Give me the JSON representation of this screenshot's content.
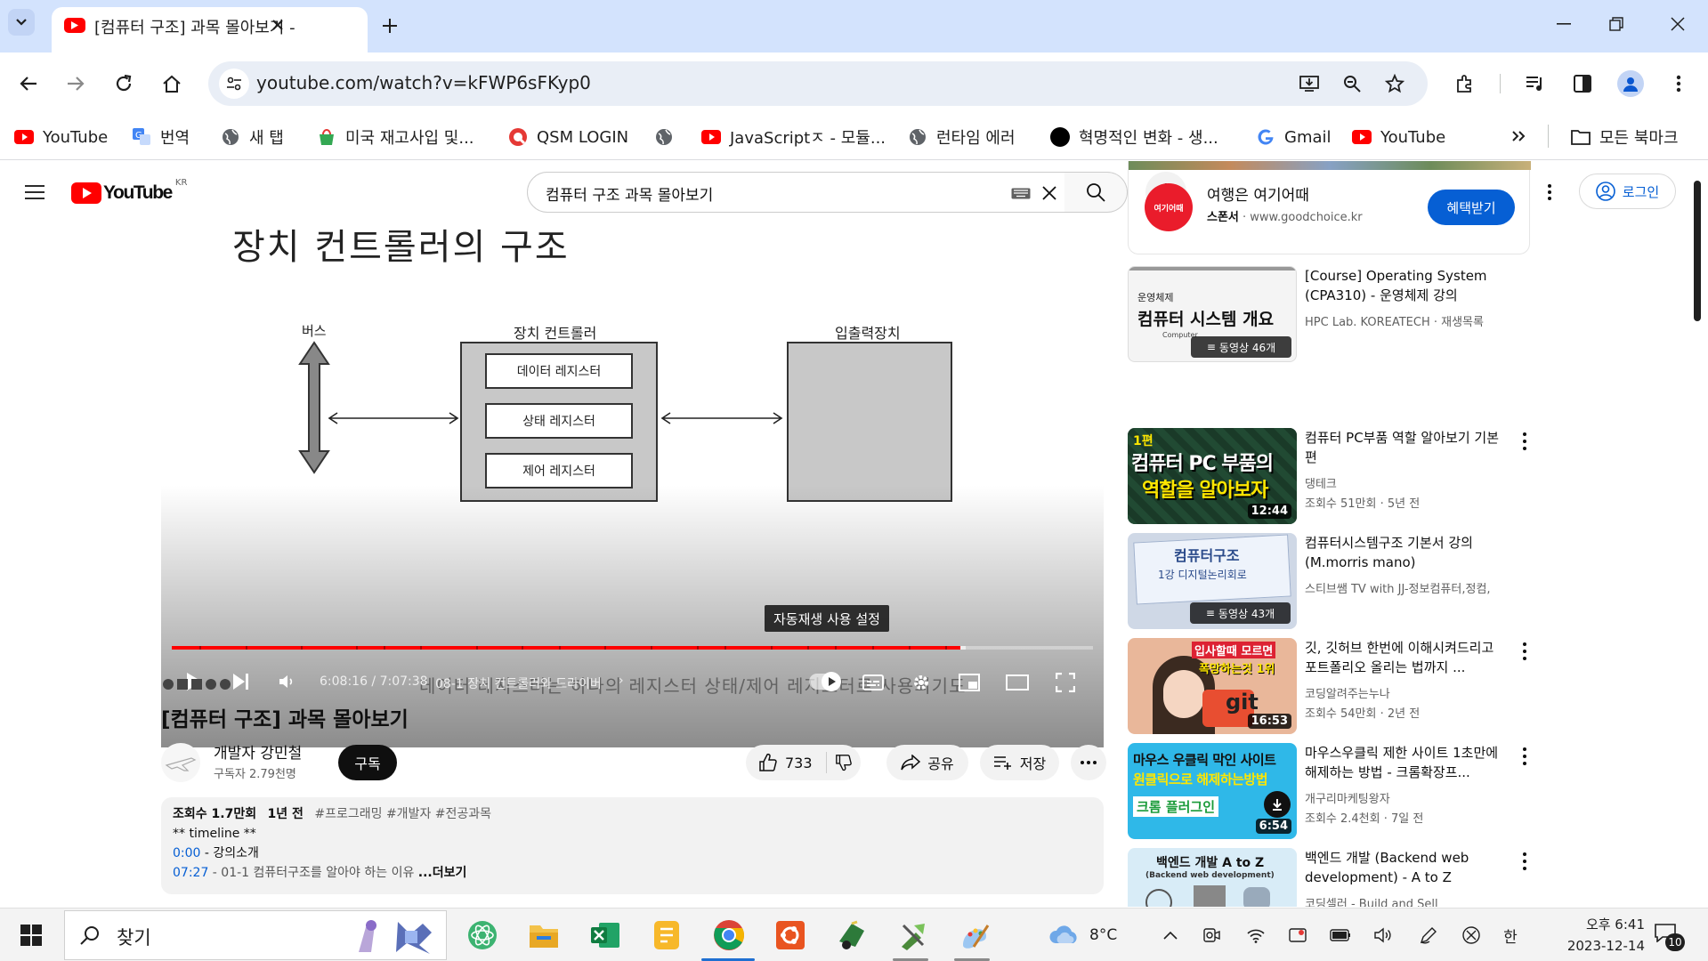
{
  "browser": {
    "tab_title": "[컴퓨터 구조] 과목 몰아보기 -",
    "url": "youtube.com/watch?v=kFWP6sFKyp0",
    "bookmarks": [
      {
        "label": "YouTube",
        "icon": "youtube-icon"
      },
      {
        "label": "번역",
        "icon": "translate-icon"
      },
      {
        "label": "새 탭",
        "icon": "globe-icon"
      },
      {
        "label": "미국 재고사입 및...",
        "icon": "shop-icon"
      },
      {
        "label": "QSM LOGIN",
        "icon": "qsm-icon"
      },
      {
        "label": "",
        "icon": "globe-icon"
      },
      {
        "label": "JavaScriptㅈ - 모듈...",
        "icon": "youtube-icon"
      },
      {
        "label": "런타임 에러",
        "icon": "globe-icon"
      },
      {
        "label": "혁명적인 변화 - 생...",
        "icon": "black-circle-icon"
      },
      {
        "label": "Gmail",
        "icon": "google-icon"
      },
      {
        "label": "YouTube",
        "icon": "youtube-icon"
      }
    ],
    "all_bookmarks": "모든 북마크"
  },
  "youtube": {
    "logo_region": "KR",
    "logo_text": "YouTube",
    "search_query": "컴퓨터 구조 과목 몰아보기",
    "login_label": "로그인",
    "video": {
      "slide_title": "장치 컨트롤러의 구조",
      "diagram": {
        "bus_label": "버스",
        "controller_label": "장치 컨트롤러",
        "io_label": "입출력장치",
        "registers": [
          "데이터 레지스터",
          "상태 레지스터",
          "제어 레지스터"
        ]
      },
      "caption": "데이터 레지스터는 하나의 레지스터 상태/제어 레지스터로 사용되기도",
      "autoplay_tooltip": "자동재생 사용 설정",
      "time": "6:08:16 / 7:07:38",
      "chapter": "08-1 장치 컨트롤러와 드라이버",
      "progress": 0.856,
      "buffered": 0.862
    },
    "title": "[컴퓨터 구조] 과목 몰아보기",
    "channel": {
      "name": "개발자 강민철",
      "subscribers": "구독자 2.79천명"
    },
    "subscribe_label": "구독",
    "like_count": "733",
    "share_label": "공유",
    "save_label": "저장",
    "description": {
      "views": "조회수 1.7만회",
      "age": "1년 전",
      "tags": "#프로그래밍 #개발자 #전공과목",
      "line1": "** timeline **",
      "t1": "0:00",
      "l1": " - 강의소개",
      "t2": "07:27",
      "l2": " - 01-1 컴퓨터구조를 알아야 하는 이유",
      "more": "...더보기"
    },
    "ad": {
      "logo": "여기어때",
      "title": "여행은 여기어때",
      "sponsor": "스폰서",
      "url": "www.goodchoice.kr",
      "button": "혜택받기"
    },
    "recommendations": [
      {
        "title": "[Course] Operating System (CPA310) - 운영체제 강의",
        "channel": "HPC Lab. KOREATECH · 재생목록",
        "meta": "",
        "thumb_caption": "운영체제",
        "thumb_main": "컴퓨터 시스템 개요",
        "thumb_sub": "Computer",
        "badge": "동영상 46개",
        "thumb_bg": "#f4f4f4"
      },
      {
        "title": "컴퓨터 PC부품 역할 알아보기 기본편",
        "channel": "댕테크",
        "meta": "조회수 51만회 · 5년 전",
        "thumb_caption": "1편",
        "thumb_main": "컴퓨터 PC 부품의",
        "thumb_sub": "역할을 알아보자",
        "badge": "12:44",
        "thumb_bg": "#1b3a2a"
      },
      {
        "title": "컴퓨터시스템구조 기본서 강의 (M.morris mano)",
        "channel": "스티브쌤 TV with JJ-정보컴퓨터,정컴,",
        "meta": "",
        "thumb_caption": "",
        "thumb_main": "컴퓨터구조",
        "thumb_sub": "1강 디지털논리회로",
        "badge": "동영상 43개",
        "thumb_bg": "#cfd8e6"
      },
      {
        "title": "깃, 깃허브 한번에 이해시켜드리고 포트폴리오 올리는 법까지 ...",
        "channel": "코딩알려주는누나",
        "meta": "조회수 54만회 · 2년 전",
        "thumb_caption": "입사할때 모르면",
        "thumb_main": "폭망하는것 1위",
        "thumb_sub": "git",
        "badge": "16:53",
        "thumb_bg": "#e9b79a"
      },
      {
        "title": "마우스우클릭 제한 사이트 1초만에 해제하는 방법 - 크롬확장프...",
        "channel": "개구리마케팅왕자",
        "meta": "조회수 2.4천회 · 7일 전",
        "thumb_caption": "마우스 우클릭 막인 사이트",
        "thumb_main": "원클릭으로 해제하는방법",
        "thumb_sub": "크롬 플러그인",
        "badge": "6:54",
        "thumb_bg": "#2fb8e8"
      },
      {
        "title": "백엔드 개발 (Backend web development) - A to Z",
        "channel": "코딩셀러 - Build and Sell",
        "meta": "",
        "thumb_caption": "백엔드 개발 A to Z",
        "thumb_main": "(Backend web development)",
        "thumb_sub": "",
        "badge": "",
        "thumb_bg": "#d8ecf7"
      }
    ]
  },
  "taskbar": {
    "search_placeholder": "찾기",
    "weather": "8°C",
    "ime": "한",
    "time": "오후 6:41",
    "date": "2023-12-14",
    "notifications": "10"
  }
}
